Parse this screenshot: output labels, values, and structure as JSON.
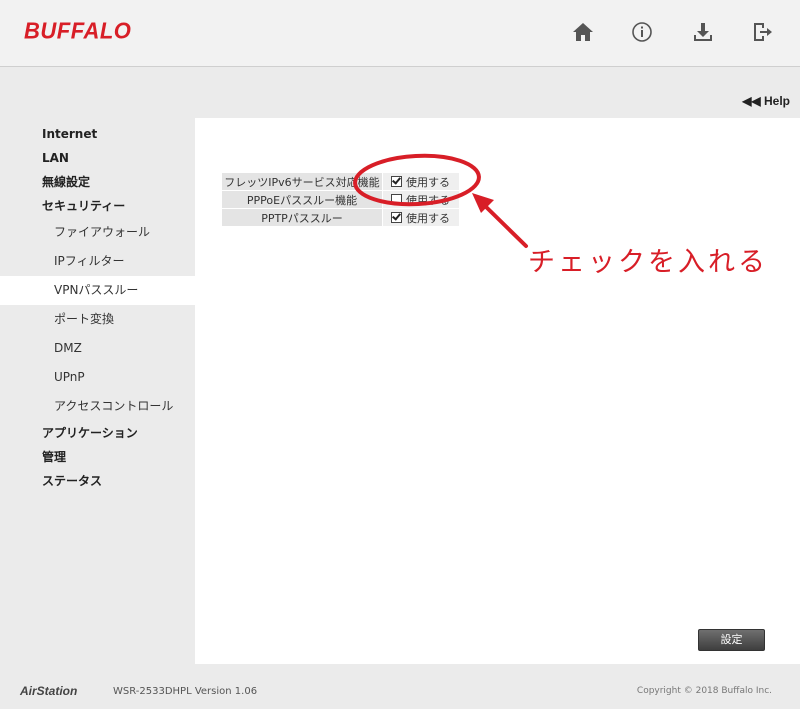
{
  "header": {
    "brand": "BUFFALO",
    "icons": [
      "home-icon",
      "info-icon",
      "download-icon",
      "logout-icon"
    ]
  },
  "help_link": "◀◀ Help",
  "sidebar": {
    "items": [
      {
        "label": "Internet",
        "level": 1
      },
      {
        "label": "LAN",
        "level": 1
      },
      {
        "label": "無線設定",
        "level": 1
      },
      {
        "label": "セキュリティー",
        "level": 1
      },
      {
        "label": "ファイアウォール",
        "level": 2
      },
      {
        "label": "IPフィルター",
        "level": 2
      },
      {
        "label": "VPNパススルー",
        "level": 2,
        "active": true
      },
      {
        "label": "ポート変換",
        "level": 2
      },
      {
        "label": "DMZ",
        "level": 2
      },
      {
        "label": "UPnP",
        "level": 2
      },
      {
        "label": "アクセスコントロール",
        "level": 2
      },
      {
        "label": "アプリケーション",
        "level": 1
      },
      {
        "label": "管理",
        "level": 1
      },
      {
        "label": "ステータス",
        "level": 1
      }
    ]
  },
  "settings": {
    "rows": [
      {
        "label": "フレッツIPv6サービス対応機能",
        "checkbox_label": "使用する",
        "checked": true
      },
      {
        "label": "PPPoEパススルー機能",
        "checkbox_label": "使用する",
        "checked": false
      },
      {
        "label": "PPTPパススルー",
        "checkbox_label": "使用する",
        "checked": true
      }
    ]
  },
  "annotation": {
    "text": "チェックを入れる",
    "color": "#d81e27"
  },
  "save_button": "設定",
  "footer": {
    "product": "AirStation",
    "model": "WSR-2533DHPL  Version 1.06",
    "copyright": "Copyright © 2018 Buffalo Inc."
  },
  "colors": {
    "brand": "#d81e27",
    "background": "#ebebeb",
    "panel": "#ffffff"
  }
}
